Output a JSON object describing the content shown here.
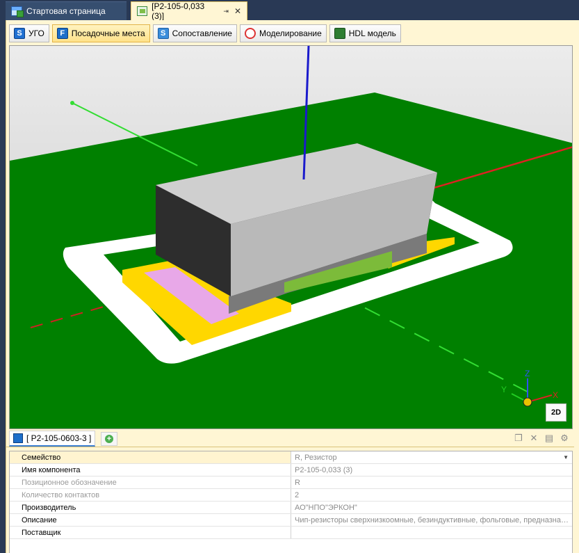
{
  "doc_tabs": [
    {
      "label": "Стартовая страница",
      "icon": "app-icon"
    },
    {
      "label": "[P2-105-0,033 (3)]",
      "icon": "component-icon",
      "pin": "⇥",
      "close": "✕"
    }
  ],
  "toolbar": {
    "buttons": [
      {
        "label": "УГО",
        "icon_glyph": "S"
      },
      {
        "label": "Посадочные места",
        "icon_glyph": "F"
      },
      {
        "label": "Сопоставление",
        "icon_glyph": "S"
      },
      {
        "label": "Моделирование",
        "icon_glyph": ""
      },
      {
        "label": "HDL модель",
        "icon_glyph": ""
      }
    ]
  },
  "viewport": {
    "axes": {
      "x": "X",
      "y": "Y",
      "z": "Z"
    },
    "mode_button": "2D"
  },
  "bottom_tabs": {
    "component_tab": "[ P2-105-0603-3 ]",
    "add_glyph": "+"
  },
  "properties": [
    {
      "name": "Семейство",
      "value": "R, Резистор",
      "dropdown": true
    },
    {
      "name": "Имя компонента",
      "value": "Р2-105-0,033 (3)"
    },
    {
      "name": "Позиционное обозначение",
      "value": "R",
      "disabled": true
    },
    {
      "name": "Количество контактов",
      "value": "2",
      "disabled": true
    },
    {
      "name": "Производитель",
      "value": "АО\"НПО\"ЭРКОН\""
    },
    {
      "name": "Описание",
      "value": "Чип-резисторы сверхнизкоомные, безиндуктивные, фольговые, предназна…"
    },
    {
      "name": "Поставщик",
      "value": ""
    }
  ],
  "colors": {
    "board": "#008000",
    "body": "#c8c8c8",
    "pad": "#ffd700",
    "resistive": "#e8a8e8",
    "silkscreen": "#ffffff",
    "axis_x": "#cc2222",
    "axis_y": "#33dd33",
    "axis_z": "#1a1acc"
  }
}
